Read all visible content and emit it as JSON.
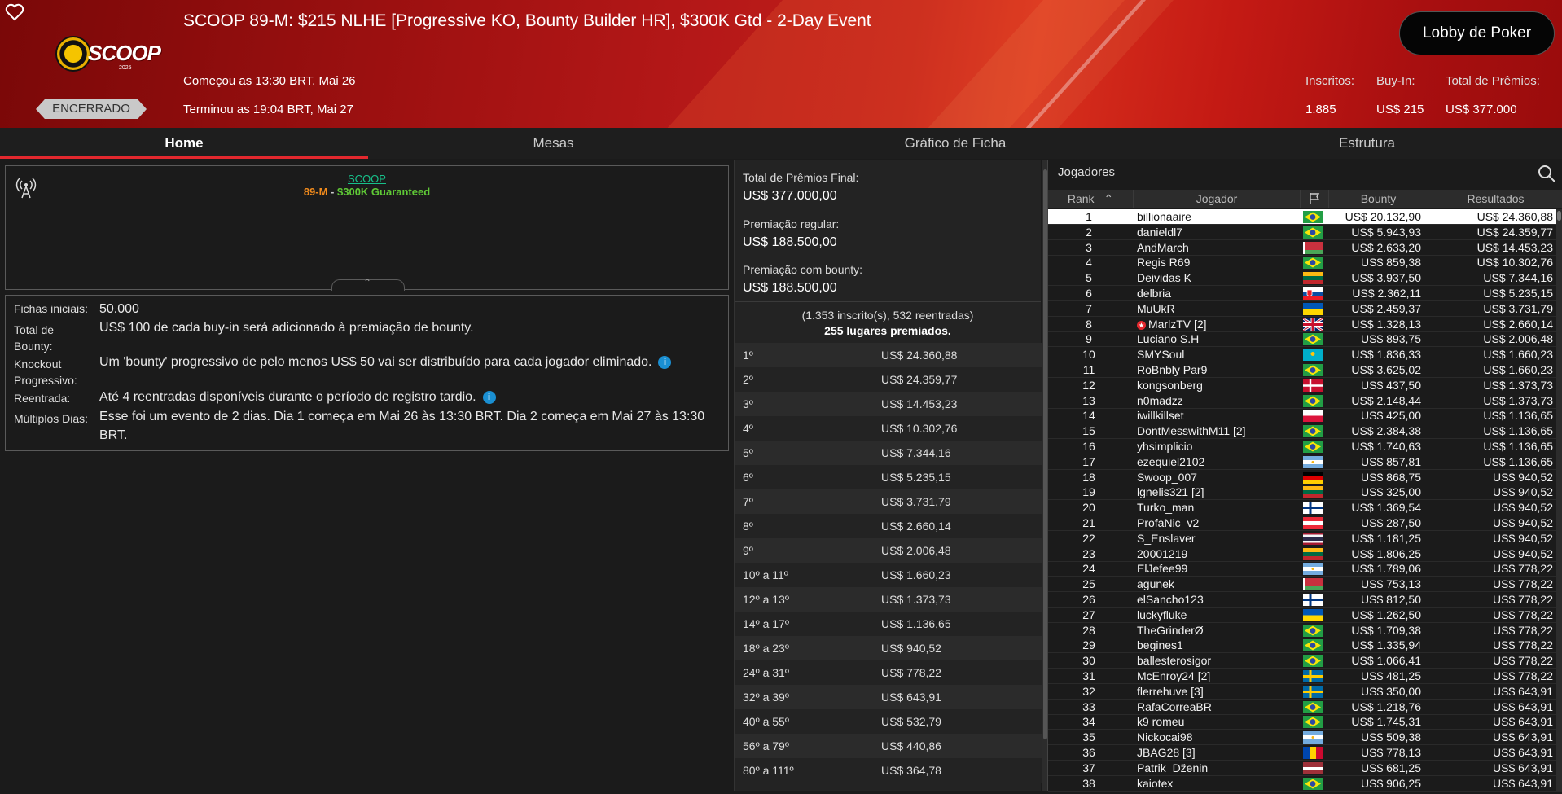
{
  "header": {
    "title": "SCOOP 89-M: $215 NLHE [Progressive KO, Bounty Builder HR], $300K Gtd - 2-Day Event",
    "logo_text": "SCOOP",
    "logo_year": "2025",
    "status": "ENCERRADO",
    "started": "Começou as 13:30 BRT, Mai 26",
    "ended": "Terminou as 19:04 BRT, Mai 27",
    "lobby_button": "Lobby de Poker",
    "stats": {
      "entrants_label": "Inscritos:",
      "entrants_value": "1.885",
      "buyin_label": "Buy-In:",
      "buyin_value": "US$ 215",
      "prize_label": "Total de Prêmios:",
      "prize_value": "US$ 377.000"
    }
  },
  "tabs": [
    "Home",
    "Mesas",
    "Gráfico de Ficha",
    "Estrutura"
  ],
  "banner": {
    "line1": "SCOOP",
    "line2_a": "89-M",
    "line2_sep": " - ",
    "line2_b": "$300K Guaranteed"
  },
  "info": [
    {
      "label": "Fichas iniciais:",
      "text": "50.000"
    },
    {
      "label": "Total de Bounty:",
      "text": "US$ 100 de cada buy-in será adicionado à premiação de bounty."
    },
    {
      "label": "Knockout Progressivo:",
      "text": "Um 'bounty' progressivo de pelo menos US$ 50 vai ser distribuído para cada jogador eliminado."
    },
    {
      "label": "Reentrada:",
      "text": "Até 4 reentradas disponíveis durante o período de registro tardio."
    },
    {
      "label": "Múltiplos Dias:",
      "text": "Esse foi um evento de 2 dias. Dia 1 começa em Mai 26 às 13:30 BRT. Dia 2 começa em Mai 27 às 13:30 BRT."
    }
  ],
  "prizes": {
    "total_label": "Total de Prêmios Final:",
    "total_value": "US$ 377.000,00",
    "regular_label": "Premiação regular:",
    "regular_value": "US$ 188.500,00",
    "bounty_label": "Premiação com bounty:",
    "bounty_value": "US$ 188.500,00",
    "entries_note": "(1.353 inscrito(s), 532 reentradas)",
    "places_note": "255 lugares premiados.",
    "table": [
      {
        "place": "1º",
        "amount": "US$ 24.360,88"
      },
      {
        "place": "2º",
        "amount": "US$ 24.359,77"
      },
      {
        "place": "3º",
        "amount": "US$ 14.453,23"
      },
      {
        "place": "4º",
        "amount": "US$ 10.302,76"
      },
      {
        "place": "5º",
        "amount": "US$ 7.344,16"
      },
      {
        "place": "6º",
        "amount": "US$ 5.235,15"
      },
      {
        "place": "7º",
        "amount": "US$ 3.731,79"
      },
      {
        "place": "8º",
        "amount": "US$ 2.660,14"
      },
      {
        "place": "9º",
        "amount": "US$ 2.006,48"
      },
      {
        "place": "10º a 11º",
        "amount": "US$ 1.660,23"
      },
      {
        "place": "12º a 13º",
        "amount": "US$ 1.373,73"
      },
      {
        "place": "14º a 17º",
        "amount": "US$ 1.136,65"
      },
      {
        "place": "18º a 23º",
        "amount": "US$ 940,52"
      },
      {
        "place": "24º a 31º",
        "amount": "US$ 778,22"
      },
      {
        "place": "32º a 39º",
        "amount": "US$ 643,91"
      },
      {
        "place": "40º a 55º",
        "amount": "US$ 532,79"
      },
      {
        "place": "56º a 79º",
        "amount": "US$ 440,86"
      },
      {
        "place": "80º a 111º",
        "amount": "US$ 364,78"
      }
    ]
  },
  "players": {
    "title": "Jogadores",
    "columns": {
      "rank": "Rank",
      "player": "Jogador",
      "bounty": "Bounty",
      "results": "Resultados"
    },
    "colors": {
      "selected_row": "#ffffff"
    },
    "rows": [
      {
        "rank": "1",
        "name": "billionaaire",
        "flag": "br",
        "bounty": "US$ 20.132,90",
        "result": "US$ 24.360,88"
      },
      {
        "rank": "2",
        "name": "danieldl7",
        "flag": "br",
        "bounty": "US$ 5.943,93",
        "result": "US$ 24.359,77"
      },
      {
        "rank": "3",
        "name": "AndMarch",
        "flag": "by",
        "bounty": "US$ 2.633,20",
        "result": "US$ 14.453,23"
      },
      {
        "rank": "4",
        "name": "Regis R69",
        "flag": "br",
        "bounty": "US$ 859,38",
        "result": "US$ 10.302,76"
      },
      {
        "rank": "5",
        "name": "Deividas K",
        "flag": "lt",
        "bounty": "US$ 3.937,50",
        "result": "US$ 7.344,16"
      },
      {
        "rank": "6",
        "name": "delbria",
        "flag": "sk",
        "bounty": "US$ 2.362,11",
        "result": "US$ 5.235,15"
      },
      {
        "rank": "7",
        "name": "MuUkR",
        "flag": "ua",
        "bounty": "US$ 2.459,37",
        "result": "US$ 3.731,79"
      },
      {
        "rank": "8",
        "name": "MarlzTV [2]",
        "flag": "gb",
        "bounty": "US$ 1.328,13",
        "result": "US$ 2.660,14",
        "star": true
      },
      {
        "rank": "9",
        "name": "Luciano S.H",
        "flag": "br",
        "bounty": "US$ 893,75",
        "result": "US$ 2.006,48"
      },
      {
        "rank": "10",
        "name": "SMYSoul",
        "flag": "kz",
        "bounty": "US$ 1.836,33",
        "result": "US$ 1.660,23"
      },
      {
        "rank": "11",
        "name": "RoBnbly Par9",
        "flag": "br",
        "bounty": "US$ 3.625,02",
        "result": "US$ 1.660,23"
      },
      {
        "rank": "12",
        "name": "kongsonberg",
        "flag": "dk",
        "bounty": "US$ 437,50",
        "result": "US$ 1.373,73"
      },
      {
        "rank": "13",
        "name": "n0madzz",
        "flag": "br",
        "bounty": "US$ 2.148,44",
        "result": "US$ 1.373,73"
      },
      {
        "rank": "14",
        "name": "iwillkillset",
        "flag": "pl",
        "bounty": "US$ 425,00",
        "result": "US$ 1.136,65"
      },
      {
        "rank": "15",
        "name": "DontMesswithM11 [2]",
        "flag": "br",
        "bounty": "US$ 2.384,38",
        "result": "US$ 1.136,65"
      },
      {
        "rank": "16",
        "name": "yhsimplicio",
        "flag": "br",
        "bounty": "US$ 1.740,63",
        "result": "US$ 1.136,65"
      },
      {
        "rank": "17",
        "name": "ezequiel2102",
        "flag": "ar",
        "bounty": "US$ 857,81",
        "result": "US$ 1.136,65"
      },
      {
        "rank": "18",
        "name": "Swoop_007",
        "flag": "de",
        "bounty": "US$ 868,75",
        "result": "US$ 940,52"
      },
      {
        "rank": "19",
        "name": "lgnelis321 [2]",
        "flag": "lt",
        "bounty": "US$ 325,00",
        "result": "US$ 940,52"
      },
      {
        "rank": "20",
        "name": "Turko_man",
        "flag": "fi",
        "bounty": "US$ 1.369,54",
        "result": "US$ 940,52"
      },
      {
        "rank": "21",
        "name": "ProfaNic_v2",
        "flag": "at",
        "bounty": "US$ 287,50",
        "result": "US$ 940,52"
      },
      {
        "rank": "22",
        "name": "S_Enslaver",
        "flag": "th",
        "bounty": "US$ 1.181,25",
        "result": "US$ 940,52"
      },
      {
        "rank": "23",
        "name": "20001219",
        "flag": "lt",
        "bounty": "US$ 1.806,25",
        "result": "US$ 940,52"
      },
      {
        "rank": "24",
        "name": "ElJefee99",
        "flag": "ar",
        "bounty": "US$ 1.789,06",
        "result": "US$ 778,22"
      },
      {
        "rank": "25",
        "name": "agunek",
        "flag": "by",
        "bounty": "US$ 753,13",
        "result": "US$ 778,22"
      },
      {
        "rank": "26",
        "name": "elSancho123",
        "flag": "fi",
        "bounty": "US$ 812,50",
        "result": "US$ 778,22"
      },
      {
        "rank": "27",
        "name": "luckyfluke",
        "flag": "ua",
        "bounty": "US$ 1.262,50",
        "result": "US$ 778,22"
      },
      {
        "rank": "28",
        "name": "TheGrinderØ",
        "flag": "br",
        "bounty": "US$ 1.709,38",
        "result": "US$ 778,22"
      },
      {
        "rank": "29",
        "name": "begines1",
        "flag": "br",
        "bounty": "US$ 1.335,94",
        "result": "US$ 778,22"
      },
      {
        "rank": "30",
        "name": "ballesterosigor",
        "flag": "br",
        "bounty": "US$ 1.066,41",
        "result": "US$ 778,22"
      },
      {
        "rank": "31",
        "name": "McEnroy24 [2]",
        "flag": "se",
        "bounty": "US$ 481,25",
        "result": "US$ 778,22"
      },
      {
        "rank": "32",
        "name": "flerrehuve [3]",
        "flag": "se",
        "bounty": "US$ 350,00",
        "result": "US$ 643,91"
      },
      {
        "rank": "33",
        "name": "RafaCorreaBR",
        "flag": "br",
        "bounty": "US$ 1.218,76",
        "result": "US$ 643,91"
      },
      {
        "rank": "34",
        "name": "k9 romeu",
        "flag": "br",
        "bounty": "US$ 1.745,31",
        "result": "US$ 643,91"
      },
      {
        "rank": "35",
        "name": "Nickocai98",
        "flag": "ar",
        "bounty": "US$ 509,38",
        "result": "US$ 643,91"
      },
      {
        "rank": "36",
        "name": "JBAG28 [3]",
        "flag": "md",
        "bounty": "US$ 778,13",
        "result": "US$ 643,91"
      },
      {
        "rank": "37",
        "name": "Patrik_Dženin",
        "flag": "lv",
        "bounty": "US$ 681,25",
        "result": "US$ 643,91"
      },
      {
        "rank": "38",
        "name": "kaiotex",
        "flag": "br",
        "bounty": "US$ 906,25",
        "result": "US$ 643,91"
      }
    ]
  }
}
